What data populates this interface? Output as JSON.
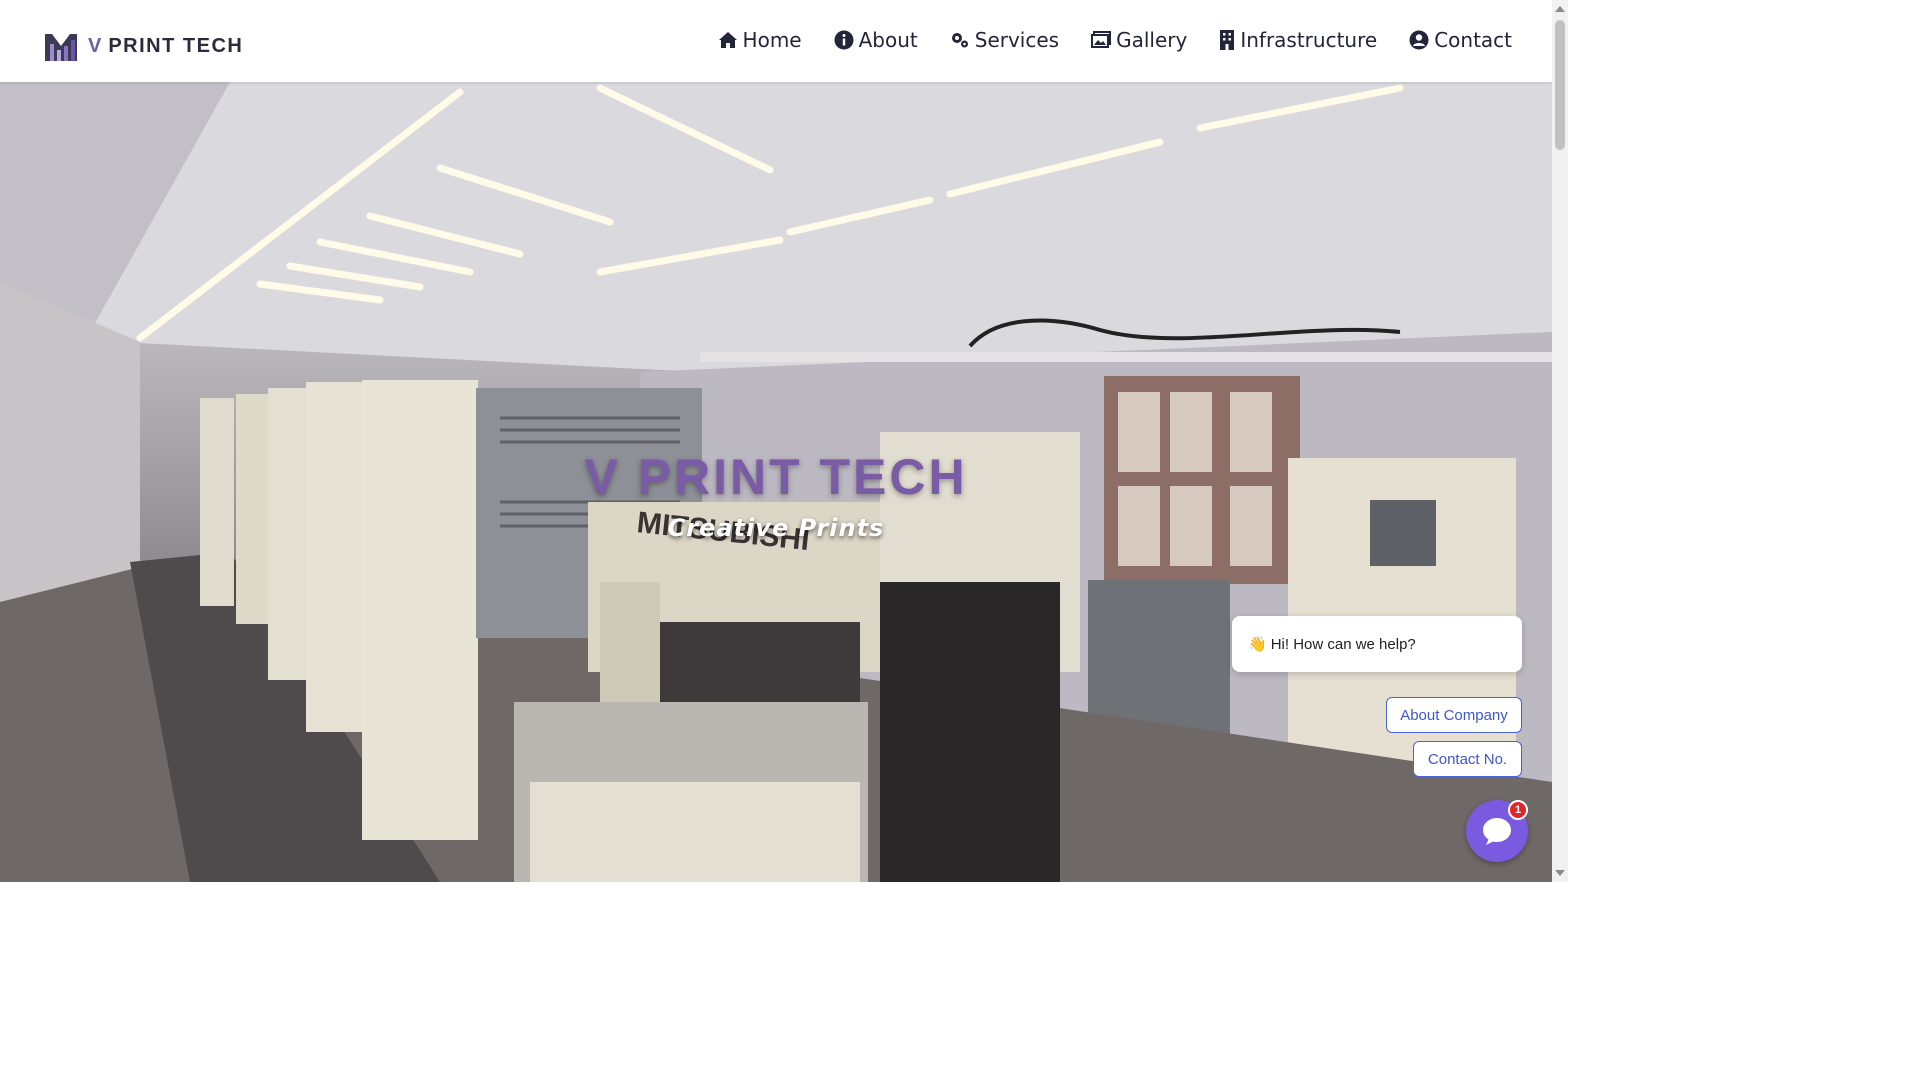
{
  "brand": {
    "mark_letter": "V",
    "name": "PRINT TECH"
  },
  "nav": {
    "items": [
      {
        "label": "Home",
        "icon": "home-icon"
      },
      {
        "label": "About",
        "icon": "info-icon"
      },
      {
        "label": "Services",
        "icon": "gears-icon"
      },
      {
        "label": "Gallery",
        "icon": "images-icon"
      },
      {
        "label": "Infrastructure",
        "icon": "building-icon"
      },
      {
        "label": "Contact",
        "icon": "user-circle-icon"
      }
    ]
  },
  "hero": {
    "title": "V PRINT TECH",
    "subtitle": "Creative Prints",
    "background": "printing press machinery photo"
  },
  "chat": {
    "greeting_emoji": "👋",
    "greeting": "Hi! How can we help?",
    "options": [
      "About Company",
      "Contact No."
    ],
    "badge_count": "1",
    "accent_color": "#7a5be0"
  },
  "colors": {
    "brand_purple": "#7a5ba6",
    "nav_text": "#23253a"
  }
}
